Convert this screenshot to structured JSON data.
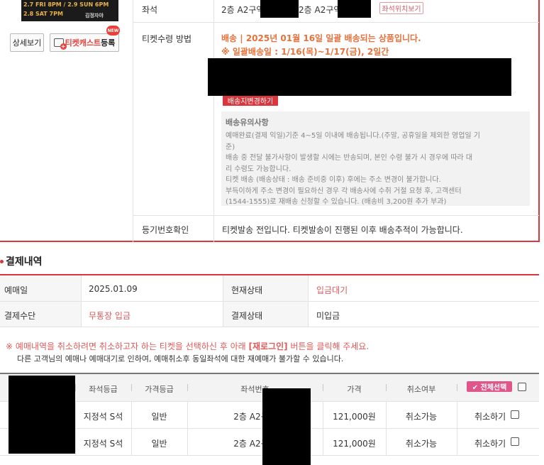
{
  "poster": {
    "line1": "2.7 FRI 8PM  /  2.9 SUN 6PM",
    "line2": "2.8 SAT 7PM",
    "venue": "김정자야"
  },
  "left_buttons": {
    "detail": "상세보기",
    "ticketcast_prefix": "티켓캐스트",
    "ticketcast_suffix": "등록",
    "new_badge": "NEW"
  },
  "booking_info": {
    "seat_label": "좌석",
    "seat_value_a": "2층 A2구역",
    "seat_value_b": "2층 A2구역",
    "seat_location_button": "좌석위치보기",
    "receive_label": "티켓수령 방법",
    "ship_line1": "배송 | 2025년 01월 16일 일괄 배송되는 상품입니다.",
    "ship_line2": "※ 일괄배송일 : 1/16(목)~1/17(금), 2일간",
    "change_address_button": "배송지변경하기",
    "notice_title": "배송유의사항",
    "notice_lines": [
      "예매완료(결제 익일)기준 4~5일 이내에 배송됩니다.(주말, 공휴일을 제외한 영업일 기",
      "준)",
      "배송 중 전달 불가사항이 발생할 시에는 반송되며, 본인 수령 불가 시 경우에 따라 대",
      "리 수령도 가능합니다.",
      "티켓 배송 (배송상태 : 배송 준비중 이후) 후에는 주소 변경이 불가합니다.",
      "부득이하게 주소 변경이 필요하신 경우 각 배송사에 수취 거절 요청 후, 고객센터",
      "(1544-1555)로 재배송 신청할 수 있습니다. (배송비 3,200원 추가 부과)"
    ],
    "registered_label": "등기번호확인",
    "registered_value": "티켓발송 전입니다. 티켓발송이 진행된 이후 배송추적이 가능합니다."
  },
  "payment": {
    "section_title": "결제내역",
    "booking_date_label": "예매일",
    "booking_date_value": "2025.01.09",
    "status_label": "현재상태",
    "status_value": "입금대기",
    "method_label": "결제수단",
    "method_value": "무통장 입금",
    "pay_status_label": "결제상태",
    "pay_status_value": "미입금"
  },
  "cancel_notice": {
    "line1_prefix": "※ 예매내역을 취소하려면 취소하고자 하는 티켓을 선택하신 후 아래 ",
    "line1_em": "[재로그인]",
    "line1_suffix": " 버튼을 클릭해 주세요.",
    "line2": "다른 고객님의 예매나 예매대기로 인하여, 예매취소후 동일좌석에 대한 재예매가 불가할 수 있습니다."
  },
  "tickets": {
    "headers": [
      "좌석등급",
      "가격등급",
      "좌석번호",
      "가격",
      "취소여부"
    ],
    "select_all": "✔ 전체선택",
    "cancel_label": "취소하기",
    "rows": [
      {
        "grade": "지정석 S석",
        "price_grade": "일반",
        "seat": "2층 A2구역",
        "price": "121,000원",
        "cancellable": "취소가능"
      },
      {
        "grade": "지정석 S석",
        "price_grade": "일반",
        "seat": "2층 A2구역",
        "price": "121,000원",
        "cancellable": "취소가능"
      }
    ]
  },
  "colors": {
    "accent_red": "#d9363e",
    "ship_orange": "#e8713b",
    "status_red": "#e05a5a",
    "select_pink": "#e0568a"
  }
}
